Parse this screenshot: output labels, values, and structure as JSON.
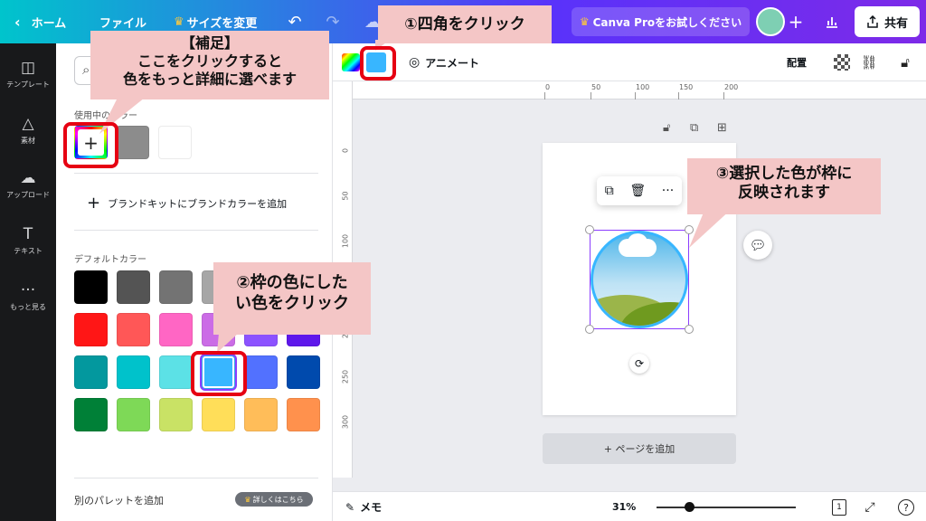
{
  "topbar": {
    "back_label": "ホーム",
    "file_label": "ファイル",
    "resize_label": "サイズを変更",
    "pro_label": "Canva Proをお試しください",
    "share_label": "共有",
    "gradient": [
      "#00c4cc",
      "#5a32fa",
      "#7d2ae8"
    ]
  },
  "rail": {
    "items": [
      {
        "label": "テンプレート",
        "icon": "layout-icon"
      },
      {
        "label": "素材",
        "icon": "elements-icon"
      },
      {
        "label": "アップロード",
        "icon": "upload-icon"
      },
      {
        "label": "テキスト",
        "icon": "text-icon"
      },
      {
        "label": "もっと見る",
        "icon": "more-icon"
      }
    ]
  },
  "panel": {
    "in_use_label": "使用中のカラー",
    "brand_add_label": "ブランドキットにブランドカラーを追加",
    "default_label": "デフォルトカラー",
    "other_palette_label": "別のパレットを追加",
    "detail_badge": "詳しくはこちら",
    "in_use_colors": [
      "#8c8c8c",
      "#ffffff"
    ],
    "default_colors": [
      [
        "#000000",
        "#545454",
        "#737373",
        "#a6a6a6",
        "#d9d9d9",
        "#ffffff"
      ],
      [
        "#ff1616",
        "#ff5757",
        "#ff66c4",
        "#cb6ce6",
        "#8c52ff",
        "#5e17eb"
      ],
      [
        "#03989e",
        "#00c2cb",
        "#5ce1e6",
        "#38b6ff",
        "#5271ff",
        "#004aad"
      ],
      [
        "#008037",
        "#7ed957",
        "#c9e265",
        "#ffde59",
        "#ffbd59",
        "#ff914d"
      ]
    ],
    "selected_color": "#38b6ff"
  },
  "toolbar": {
    "animate_label": "アニメート",
    "arrange_label": "配置",
    "current_color": "#38b6ff"
  },
  "rulers": {
    "h_ticks": [
      "0",
      "50",
      "100",
      "150",
      "200"
    ],
    "v_ticks": [
      "0",
      "50",
      "100",
      "150",
      "200",
      "250",
      "300"
    ]
  },
  "canvas": {
    "add_page_label": "+ ページを追加"
  },
  "bottombar": {
    "memo_label": "メモ",
    "zoom_label": "31%",
    "zoom_level": 0.31,
    "page_number": "1",
    "help_label": "?"
  },
  "annotations": {
    "step1": "①四角をクリック",
    "supplement_title": "【補足】",
    "supplement_line1": "ここをクリックすると",
    "supplement_line2": "色をもっと詳細に選べます",
    "step2_line1": "②枠の色にした",
    "step2_line2": "い色をクリック",
    "step3_line1": "③選択した色が枠に",
    "step3_line2": "反映されます",
    "highlight_color": "#e60012",
    "note_color": "#f4c6c6"
  }
}
